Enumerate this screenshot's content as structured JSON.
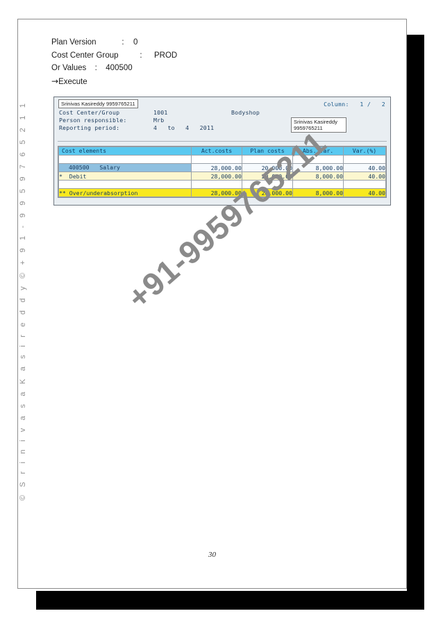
{
  "document": {
    "page_number": "30"
  },
  "instructions": [
    {
      "label": "Plan Version",
      "colon": ":",
      "value": "0"
    },
    {
      "label": "Cost Center Group",
      "colon": ":",
      "value": "PROD"
    },
    {
      "label": "Or Values",
      "colon": ":",
      "value": "400500"
    }
  ],
  "execute_line": {
    "arrow": "→",
    "label": "Execute"
  },
  "sap_report": {
    "annotation_top_left": "Srinivas Kasireddy 9959765211",
    "annotation_right": "Srinivas Kasireddy 9959765211",
    "column_indicator": "Column:   1 /   2",
    "header": {
      "cost_center_group_label": "Cost Center/Group",
      "cost_center_group_value": "1001",
      "cost_center_group_description": "Bodyshop",
      "person_responsible_label": "Person responsible:",
      "person_responsible_value": "Mrb",
      "reporting_period_label": "Reporting period:",
      "reporting_period_value": "4   to   4   2011"
    },
    "table": {
      "columns": [
        "Cost elements",
        "Act.costs",
        "Plan costs",
        "Abs. var.",
        "Var.(%)"
      ],
      "rows": [
        {
          "kind": "detail",
          "name": "400500   Salary",
          "act_costs": "28,000.00",
          "plan_costs": "20,000.00",
          "abs_var": "8,000.00",
          "var_pct": "40.00"
        },
        {
          "kind": "subtotal",
          "name": "*  Debit",
          "act_costs": "28,000.00",
          "plan_costs": "20,000.00",
          "abs_var": "8,000.00",
          "var_pct": "40.00"
        },
        {
          "kind": "total",
          "name": "** Over/underabsorption",
          "act_costs": "28,000.00",
          "plan_costs": "20,000.00",
          "abs_var": "8,000.00",
          "var_pct": "40.00"
        }
      ]
    }
  },
  "watermarks": {
    "diagonal": "+91-9959765211",
    "side": "© S r i n i v a s a   K a s i r e d d y ©  + 9 1 - 9 9 5 9 7 6 5 2 1 1"
  },
  "colors": {
    "grid_header": "#59c8f0",
    "row_selected": "#8fc0e0",
    "row_subtotal": "#fcf7cf",
    "row_total": "#f8e91f",
    "sap_background": "#e9eef2",
    "sap_text": "#1b3a5c",
    "band_black": "#000000"
  }
}
